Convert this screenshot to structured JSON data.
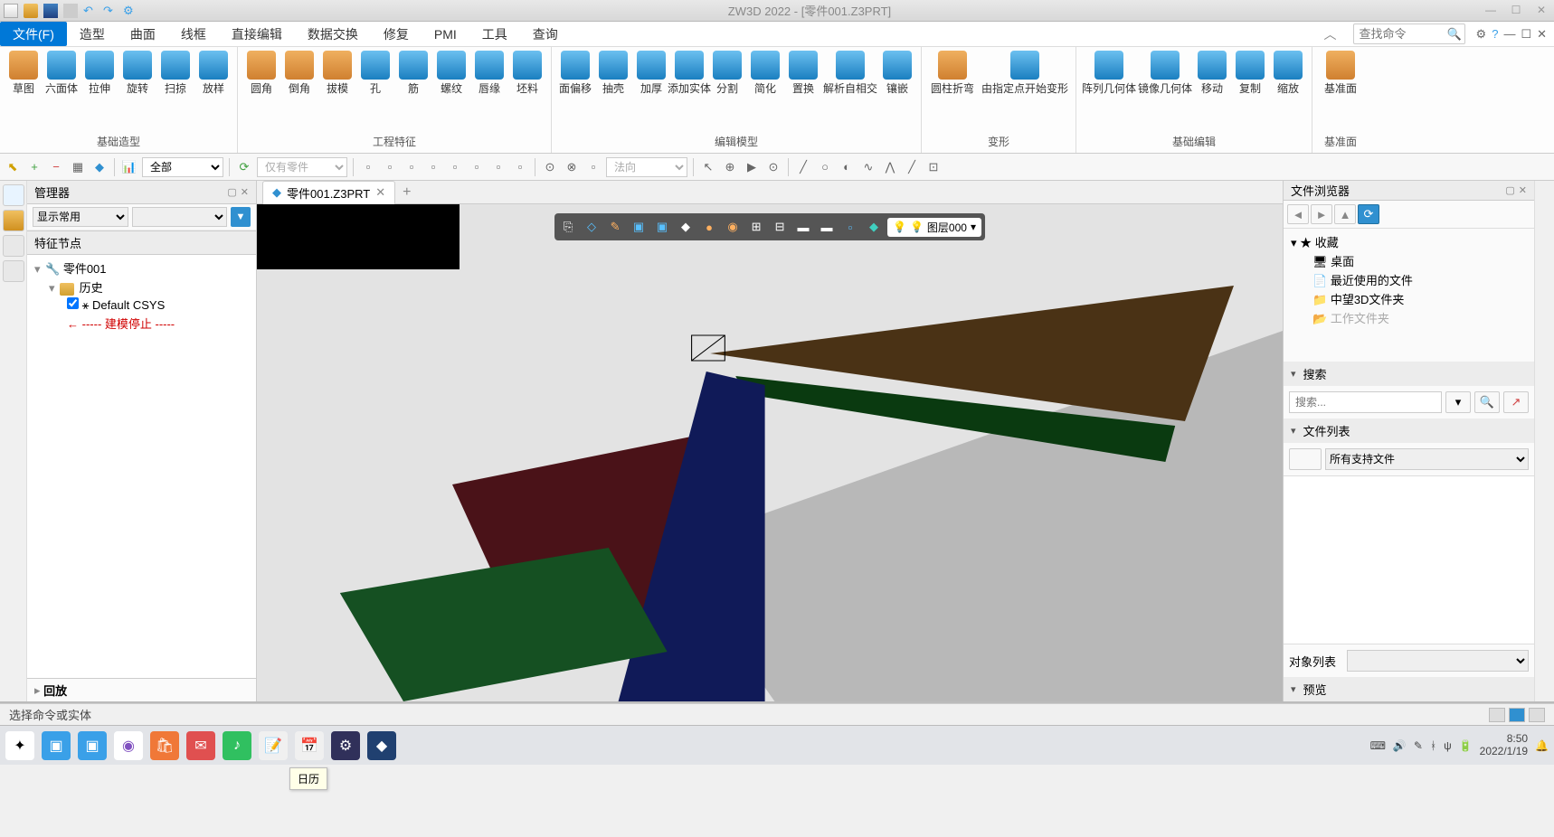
{
  "app": {
    "title": "ZW3D 2022 - [零件001.Z3PRT]",
    "caret": "︿"
  },
  "menu": {
    "file": "文件(F)",
    "items": [
      "造型",
      "曲面",
      "线框",
      "直接编辑",
      "数据交换",
      "修复",
      "PMI",
      "工具",
      "查询"
    ]
  },
  "search": {
    "placeholder": "查找命令"
  },
  "ribbon": {
    "groups": [
      {
        "label": "基础造型",
        "buttons": [
          "草图",
          "六面体",
          "拉伸",
          "旋转",
          "扫掠",
          "放样"
        ]
      },
      {
        "label": "工程特征",
        "buttons": [
          "圆角",
          "倒角",
          "拔模",
          "孔",
          "筋",
          "螺纹",
          "唇缘",
          "坯料"
        ]
      },
      {
        "label": "编辑模型",
        "buttons": [
          "面偏移",
          "抽壳",
          "加厚",
          "添加实体",
          "分割",
          "简化",
          "置换",
          "解析自相交",
          "镶嵌"
        ]
      },
      {
        "label": "变形",
        "buttons": [
          "圆柱折弯",
          "由指定点开始变形"
        ]
      },
      {
        "label": "基础编辑",
        "buttons": [
          "阵列几何体",
          "镜像几何体",
          "移动",
          "复制",
          "缩放"
        ]
      },
      {
        "label": "基准面",
        "buttons": [
          "基准面"
        ]
      }
    ]
  },
  "toolbar2": {
    "filter_all": "全部",
    "only_parts": "仅有零件",
    "direction": "法向"
  },
  "leftPanel": {
    "title": "管理器",
    "displayMode": "显示常用",
    "sectionLabel": "特征节点",
    "root": "零件001",
    "history": "历史",
    "csys": "Default CSYS",
    "stop": "----- 建模停止 -----",
    "playback": "回放"
  },
  "tabs": {
    "active": "零件001.Z3PRT"
  },
  "viewToolbar": {
    "layer": "图层000"
  },
  "rightPanel": {
    "title": "文件浏览器",
    "favorites": "收藏",
    "fav_items": [
      "桌面",
      "最近使用的文件",
      "中望3D文件夹",
      "工作文件夹"
    ],
    "searchHeader": "搜索",
    "searchPlaceholder": "搜索...",
    "fileListHeader": "文件列表",
    "fileFilter": "所有支持文件",
    "objectListLabel": "对象列表",
    "previewHeader": "预览"
  },
  "status": {
    "prompt": "选择命令或实体",
    "tooltip": "日历"
  },
  "clock": {
    "time": "8:50",
    "date": "2022/1/19"
  }
}
